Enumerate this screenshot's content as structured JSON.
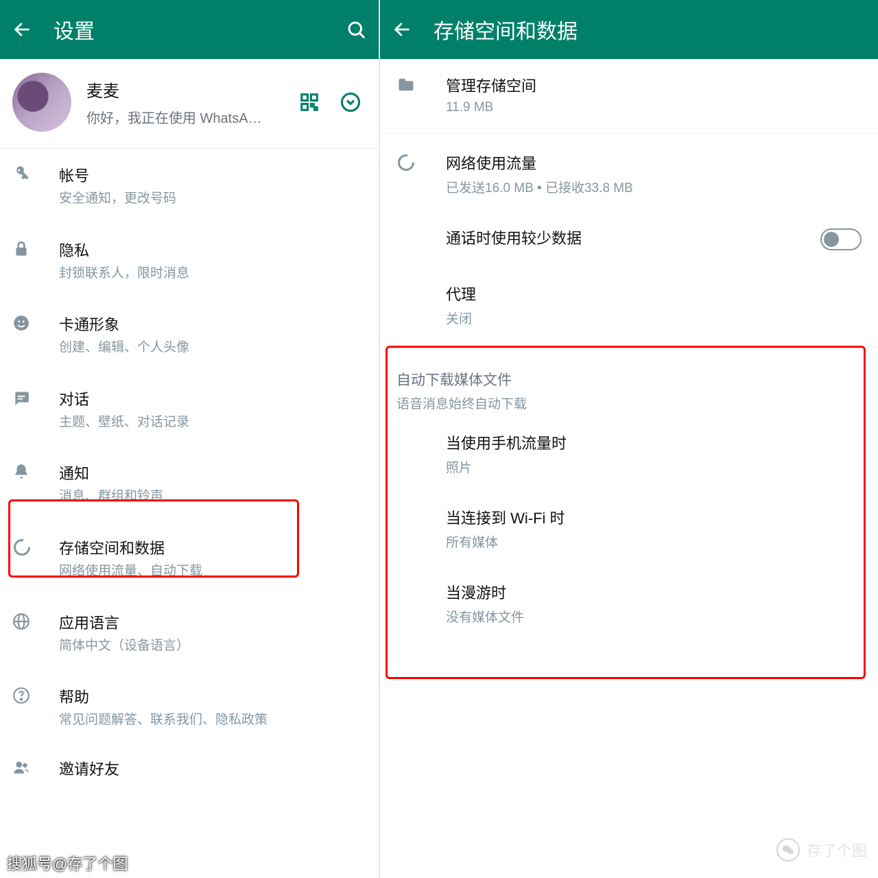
{
  "left": {
    "title": "设置",
    "profile": {
      "name": "麦麦",
      "status": "你好，我正在使用 WhatsA…"
    },
    "items": [
      {
        "label": "帐号",
        "sub": "安全通知，更改号码"
      },
      {
        "label": "隐私",
        "sub": "封锁联系人，限时消息"
      },
      {
        "label": "卡通形象",
        "sub": "创建、编辑、个人头像"
      },
      {
        "label": "对话",
        "sub": "主题、壁纸、对话记录"
      },
      {
        "label": "通知",
        "sub": "消息、群组和铃声"
      },
      {
        "label": "存储空间和数据",
        "sub": "网络使用流量、自动下载"
      },
      {
        "label": "应用语言",
        "sub": "简体中文（设备语言）"
      },
      {
        "label": "帮助",
        "sub": "常见问题解答、联系我们、隐私政策"
      },
      {
        "label": "邀请好友",
        "sub": ""
      }
    ]
  },
  "right": {
    "title": "存储空间和数据",
    "topItems": [
      {
        "label": "管理存储空间",
        "sub": "11.9 MB"
      },
      {
        "label": "网络使用流量",
        "sub": "已发送16.0 MB  •  已接收33.8 MB"
      }
    ],
    "lessDataLabel": "通话时使用较少数据",
    "proxy": {
      "label": "代理",
      "sub": "关闭"
    },
    "autoSection": {
      "title": "自动下载媒体文件",
      "sub": "语音消息始终自动下载",
      "items": [
        {
          "label": "当使用手机流量时",
          "sub": "照片"
        },
        {
          "label": "当连接到 Wi-Fi 时",
          "sub": "所有媒体"
        },
        {
          "label": "当漫游时",
          "sub": "没有媒体文件"
        }
      ]
    }
  },
  "watermarks": {
    "bottomLeft": "搜狐号@存了个图",
    "bottomRight": "存了个图"
  }
}
